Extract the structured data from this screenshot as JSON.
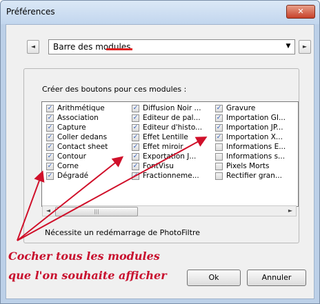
{
  "window": {
    "title": "Préférences",
    "close_label": "✕"
  },
  "nav": {
    "prev": "◄",
    "next": "►"
  },
  "combo": {
    "value": "Barre des modules",
    "arrow": "▼"
  },
  "group": {
    "label": "Créer des boutons pour ces modules :"
  },
  "modules": {
    "col1": [
      {
        "label": "Arithmétique",
        "checked": true
      },
      {
        "label": "Association",
        "checked": true
      },
      {
        "label": "Capture",
        "checked": true
      },
      {
        "label": "Coller dedans",
        "checked": true
      },
      {
        "label": "Contact sheet",
        "checked": true
      },
      {
        "label": "Contour",
        "checked": true
      },
      {
        "label": "Corne",
        "checked": true
      },
      {
        "label": "Dégradé",
        "checked": true
      }
    ],
    "col2": [
      {
        "label": "Diffusion Noir ...",
        "checked": true
      },
      {
        "label": "Editeur de pal...",
        "checked": true
      },
      {
        "label": "Editeur d'histo...",
        "checked": true
      },
      {
        "label": "Effet Lentille",
        "checked": true
      },
      {
        "label": "Effet miroir",
        "checked": true
      },
      {
        "label": "Exportation J...",
        "checked": true
      },
      {
        "label": "FontVisu",
        "checked": true
      },
      {
        "label": "Fractionneme...",
        "checked": true
      }
    ],
    "col3": [
      {
        "label": "Gravure",
        "checked": true
      },
      {
        "label": "Importation GI...",
        "checked": true
      },
      {
        "label": "Importation JP...",
        "checked": true
      },
      {
        "label": "Importation X...",
        "checked": true
      },
      {
        "label": "Informations E...",
        "checked": false
      },
      {
        "label": "Informations s...",
        "checked": false
      },
      {
        "label": "Pixels Morts",
        "checked": false
      },
      {
        "label": "Rectifier gran...",
        "checked": false
      }
    ]
  },
  "scroll": {
    "left": "◄",
    "right": "►",
    "thumb": "|||"
  },
  "restart_note": "Nécessite un redémarrage de PhotoFiltre",
  "annotation": {
    "line1": "Cocher tous les modules",
    "line2": "que l'on souhaite afficher"
  },
  "buttons": {
    "ok": "Ok",
    "cancel": "Annuler"
  },
  "colors": {
    "annotation": "#c8102e",
    "checkmark": "#2b58b8",
    "title_bar": "#c2d6ee"
  }
}
